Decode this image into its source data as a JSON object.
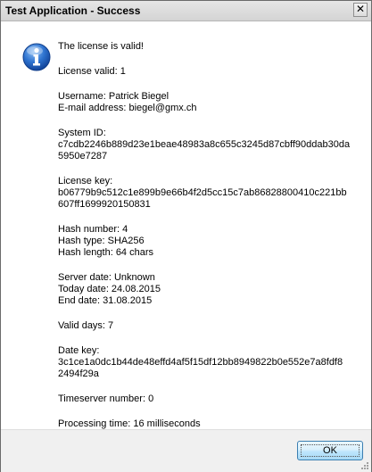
{
  "window": {
    "title": "Test Application - Success",
    "close_glyph": "✕"
  },
  "icon": "info-icon",
  "messages": [
    {
      "lines": [
        "The license is valid!"
      ]
    },
    {
      "lines": [
        "License valid: 1"
      ]
    },
    {
      "lines": [
        "Username: Patrick Biegel",
        "E-mail address: biegel@gmx.ch"
      ]
    },
    {
      "lines": [
        "System ID:",
        "c7cdb2246b889d23e1beae48983a8c655c3245d87cbff90ddab30da",
        "5950e7287"
      ]
    },
    {
      "lines": [
        "License key:",
        "b06779b9c512c1e899b9e66b4f2d5cc15c7ab86828800410c221bb",
        "607ff1699920150831"
      ]
    },
    {
      "lines": [
        "Hash number: 4",
        "Hash type: SHA256",
        "Hash length: 64 chars"
      ]
    },
    {
      "lines": [
        "Server date: Unknown",
        "Today date: 24.08.2015",
        "End date: 31.08.2015"
      ]
    },
    {
      "lines": [
        "Valid days: 7"
      ]
    },
    {
      "lines": [
        "Date key:",
        "3c1ce1a0dc1b44de48effd4af5f15df12bb8949822b0e552e7a8fdf8",
        "2494f29a"
      ]
    },
    {
      "lines": [
        "Timeserver number: 0"
      ]
    },
    {
      "lines": [
        "Processing time: 16 milliseconds"
      ]
    }
  ],
  "footer": {
    "ok_label": "OK"
  },
  "colors": {
    "icon_blue": "#1f5fb8",
    "button_border": "#3c7fb1"
  }
}
